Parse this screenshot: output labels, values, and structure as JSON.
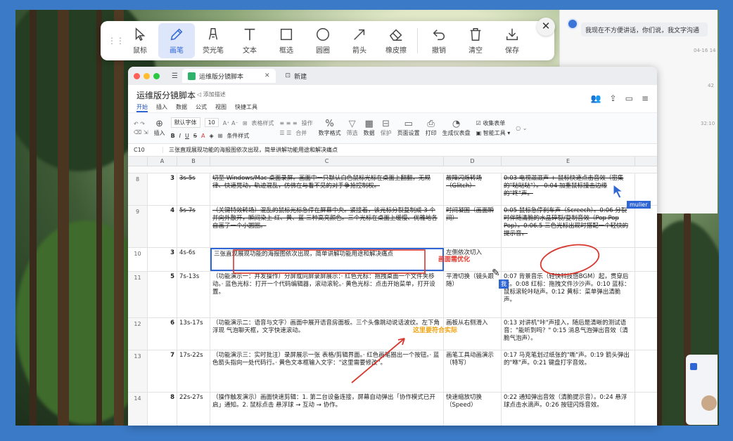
{
  "toolbar": {
    "tools": [
      {
        "label": "鼠标",
        "icon": "cursor-icon"
      },
      {
        "label": "画笔",
        "icon": "pencil-icon",
        "active": true
      },
      {
        "label": "荧光笔",
        "icon": "highlighter-icon"
      },
      {
        "label": "文本",
        "icon": "text-icon"
      },
      {
        "label": "框选",
        "icon": "rectangle-icon"
      },
      {
        "label": "圆圈",
        "icon": "circle-icon"
      },
      {
        "label": "箭头",
        "icon": "arrow-icon"
      },
      {
        "label": "橡皮擦",
        "icon": "eraser-icon"
      },
      {
        "label": "撤销",
        "icon": "undo-icon"
      },
      {
        "label": "清空",
        "icon": "trash-icon"
      },
      {
        "label": "保存",
        "icon": "download-icon"
      }
    ],
    "close": "✕"
  },
  "chat": {
    "message": "我现在不方便讲话，你们说，我文字沟通",
    "ts1": "04-16 14",
    "ts2": "42",
    "ts3": "32:10"
  },
  "window": {
    "tabs": [
      "运维版分镜脚本",
      "新建"
    ],
    "title": "运维版分镜脚本",
    "link": "添加描述",
    "menu": [
      "开始",
      "插入",
      "数据",
      "公式",
      "视图",
      "快捷工具"
    ]
  },
  "ribbon": {
    "insert": "插入",
    "font": "默认字体",
    "size": "10",
    "table_style": "表格样式",
    "cond": "条件样式",
    "merge": "合并",
    "op": "操作",
    "numfmt": "数字格式",
    "filter": "筛选",
    "data": "数据",
    "protect": "保护",
    "pagesetup": "页面设置",
    "print": "打印",
    "gen_table": "生成仪表盘",
    "collect": "收集表单",
    "smart": "智能工具"
  },
  "formula": {
    "ref": "C10",
    "text": "三张直观展现功能的海报图依次出现，简单讲解功能用途和解决痛点"
  },
  "grid": {
    "cols": [
      "A",
      "B",
      "C",
      "D",
      "E"
    ],
    "rows": [
      {
        "rn": "8",
        "a": "3",
        "b": "3s-5s",
        "c": "切至 Windows/Mac 桌面录屏。画面中一只默认白色鼠标光标在桌面上翻翻，无规律、快速晃动，轨迹混乱，仿佛在与看不见的对手争抢控制权。",
        "d": "故障闪烁转场（Glitch）",
        "e": "0:03 电视滋滋声 + 鼠标快速点击音效（密集的\"哒哒哒\"）。 0:04 加重鼠标撞击边缘的\"咚\"声。"
      },
      {
        "rn": "9",
        "a": "4",
        "b": "5s-7s",
        "c": "（关键特效转场）混乱的鼠标光标急停在屏幕中央。紧接着，该光标分裂复制成 3 个并向外散开，瞬间染上 红、黄、蓝 三种高亮颜色。三个光标在桌面上缓慢、优雅地各自画了一个小圆圈。",
        "d": "时间凝固（画面瞬间）",
        "e": "0:05 鼠标急停刹车声（Screech）。0:06 分裂时伴随清脆的水晶碎裂/复制音效（Pop Pop Pop）。0:06.5 三色光标出现时搭配一个轻快的提示音。"
      },
      {
        "rn": "10",
        "a": "3",
        "b": "4s-6s",
        "c": "三张直观展现功能的海报图依次出现，简单讲解功能用途和解决痛点",
        "d": "左侧依次切入",
        "e": ""
      },
      {
        "rn": "11",
        "a": "5",
        "b": "7s-13s",
        "c": "（功能演示一：并发操作）分屏或同屏录屏展示：· 红色光标：拖拽桌面一个文件夹移动。· 蓝色光标：打开一个代码编辑器，滚动滚轮。· 黄色光标：点击开始菜单，打开设置。",
        "d": "平滑切换（镜头跟随）",
        "e": "0:07 背景音乐（轻快科技感BGM）起，贯穿后续。0:08 红标：拖拽文件沙沙声。0:10 蓝标：鼠标滚轮咔哒声。0:12 黄标：菜单弹出清脆声。"
      },
      {
        "rn": "12",
        "a": "6",
        "b": "13s-17s",
        "c": "（功能演示二：语音与文字）画面中展开语音房面板。三个头像跳动说话波纹。左下角浮现 气泡聊天框，文字快速滚动。",
        "d": "画板从右侧滑入",
        "e": "0:13 对讲机\"咔\"声接入，随后是清晰的测试语音：\"能听到吗？\" 0:15 消息气泡弹出音效（清脆气泡声）。"
      },
      {
        "rn": "13",
        "a": "7",
        "b": "17s-22s",
        "c": "（功能演示三：实时批注）录屏展示一张 表格/剪辑界面。· 红色画笔圈出一个按钮。· 蓝色箭头指向一处代码行。· 黄色文本框输入文字：\"这里需要修改\"。",
        "d": "画笔工具动画演示（特写）",
        "e": "0:17 马克笔划过纸张的\"嘶\"声。0:19 箭头弹出的\"咻\"声。0:21 键盘打字音效。"
      },
      {
        "rn": "14",
        "a": "8",
        "b": "22s-27s",
        "c": "（操作触发演示）画面快速剪辑：1. 第二台设备连接，屏幕自动弹出「协作模式已开启」通知。2. 鼠标点击 悬浮球 → 互动 → 协作。",
        "d": "快速缩放切换（Speed）",
        "e": "0:22 通知弹出音效（清脆提示音）。0:24 悬浮球点击水滴声。0:26 按钮闪烁音效。"
      }
    ]
  },
  "annotations": {
    "note1": "画面需优化",
    "note2": "这里要符合实际",
    "user_tag": "mulier",
    "me_tag": "我"
  }
}
